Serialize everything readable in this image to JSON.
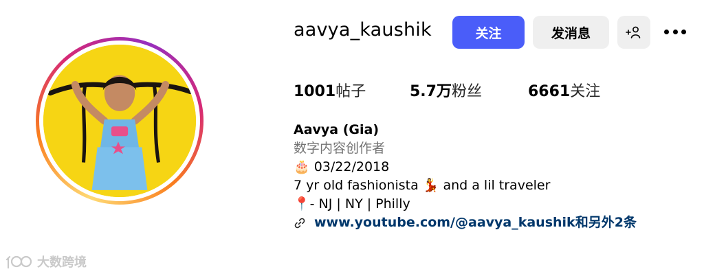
{
  "profile": {
    "username": "aavya_kaushik",
    "buttons": {
      "follow": "关注",
      "message": "发消息"
    },
    "stats": [
      {
        "value": "1001",
        "label": "帖子"
      },
      {
        "value": "5.7万",
        "label": "粉丝"
      },
      {
        "value": "6661",
        "label": "关注"
      }
    ],
    "bio": {
      "name": "Aavya (Gia)",
      "category": "数字内容创作者",
      "line1": "🎂 03/22/2018",
      "line2": "7 yr old fashionista 💃 and a lil traveler",
      "line3": "📍- NJ | NY | Philly",
      "link": "www.youtube.com/@aavya_kaushik和另外2条"
    }
  },
  "watermark": {
    "text": "大数跨境"
  },
  "colors": {
    "follow_button": "#4a5df9",
    "link": "#00376b",
    "secondary_button": "#efefef"
  },
  "icons": [
    "add-user-icon",
    "more-icon",
    "link-icon",
    "watermark-logo-icon"
  ]
}
